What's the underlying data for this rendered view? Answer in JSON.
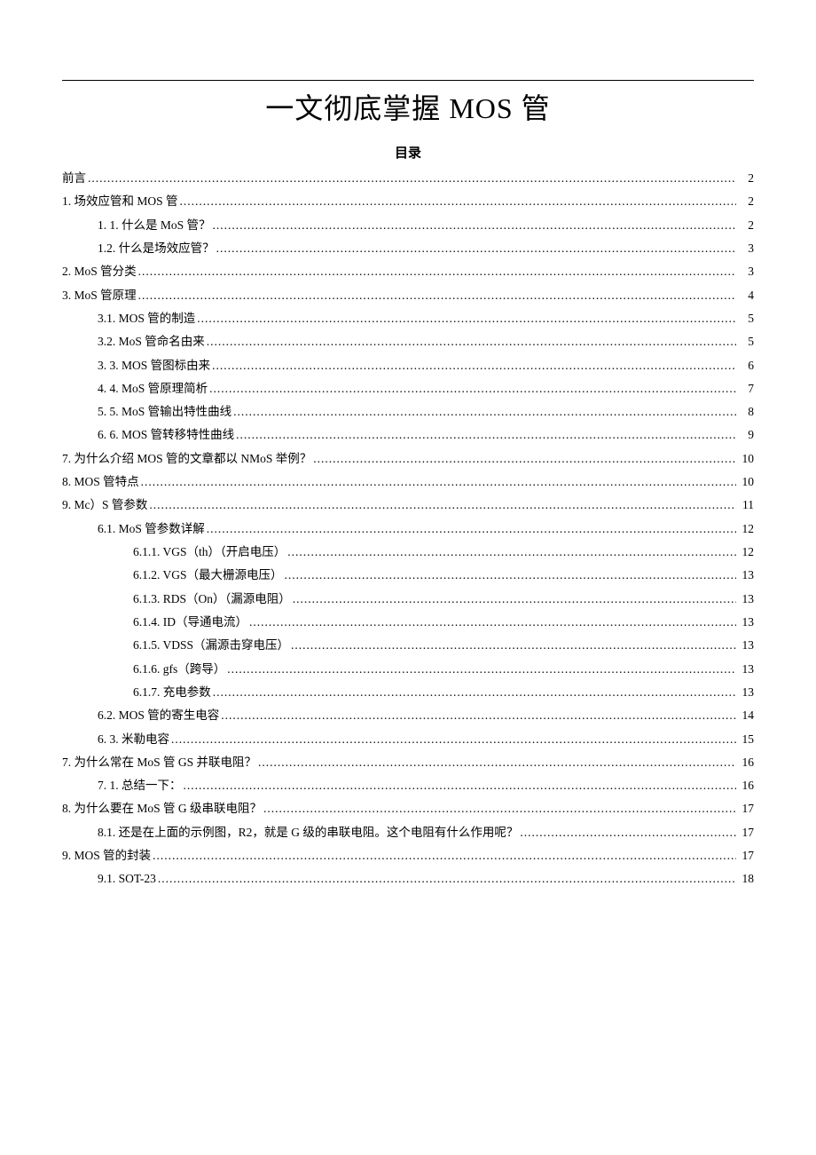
{
  "title_pre": "一文彻底掌握 ",
  "title_latin": "MOS",
  "title_post": " 管",
  "toc_heading": "目录",
  "toc": [
    {
      "level": 0,
      "label": "前言",
      "page": "2"
    },
    {
      "level": 0,
      "label": "1. 场效应管和 MOS 管",
      "page": "2"
    },
    {
      "level": 1,
      "label": "1. 1. 什么是 MoS 管？",
      "page": "2"
    },
    {
      "level": 1,
      "label": "1.2.  什么是场效应管？",
      "page": "3"
    },
    {
      "level": 0,
      "label": "2.  MoS 管分类",
      "page": "3"
    },
    {
      "level": 0,
      "label": "3.  MoS 管原理",
      "page": "4"
    },
    {
      "level": 1,
      "label": "3.1.  MOS 管的制造",
      "page": "5"
    },
    {
      "level": 1,
      "label": "3.2.  MoS 管命名由来",
      "page": "5"
    },
    {
      "level": 1,
      "label": "3. 3. MOS 管图标由来",
      "page": "6"
    },
    {
      "level": 1,
      "label": "4. 4. MoS 管原理简析",
      "page": "7"
    },
    {
      "level": 1,
      "label": "5. 5. MoS 管输出特性曲线",
      "page": "8"
    },
    {
      "level": 1,
      "label": "6. 6. MOS 管转移特性曲线",
      "page": "9"
    },
    {
      "level": 0,
      "label": "7.  为什么介绍 MOS 管的文章都以 NMoS 举例？",
      "page": "10"
    },
    {
      "level": 0,
      "label": "8.  MOS 管特点",
      "page": "10"
    },
    {
      "level": 0,
      "label": "9.  Mc）S 管参数",
      "page": "11"
    },
    {
      "level": 1,
      "label": "6.1. MoS 管参数详解",
      "page": "12"
    },
    {
      "level": 2,
      "label": "6.1.1.  VGS（th）（开启电压）",
      "page": "12"
    },
    {
      "level": 2,
      "label": "6.1.2.  VGS（最大栅源电压）",
      "page": "13"
    },
    {
      "level": 2,
      "label": "6.1.3.  RDS（On）（漏源电阻）",
      "page": "13"
    },
    {
      "level": 2,
      "label": "6.1.4.  ID（导通电流）",
      "page": "13"
    },
    {
      "level": 2,
      "label": "6.1.5.  VDSS（漏源击穿电压）",
      "page": "13"
    },
    {
      "level": 2,
      "label": "6.1.6.  gfs（跨导）",
      "page": "13"
    },
    {
      "level": 2,
      "label": "6.1.7. 充电参数",
      "page": "13"
    },
    {
      "level": 1,
      "label": "6.2. MOS 管的寄生电容",
      "page": "14"
    },
    {
      "level": 1,
      "label": "6. 3. 米勒电容",
      "page": "15"
    },
    {
      "level": 0,
      "label": "7. 为什么常在 MoS 管 GS 并联电阻？",
      "page": "16"
    },
    {
      "level": 1,
      "label": "7. 1. 总结一下：",
      "page": "16"
    },
    {
      "level": 0,
      "label": "8.  为什么要在 MoS 管 G 级串联电阻？",
      "page": "17"
    },
    {
      "level": 1,
      "label": "8.1.  还是在上面的示例图，R2，就是 G 级的串联电阻。这个电阻有什么作用呢？",
      "page": "17"
    },
    {
      "level": 0,
      "label": "9.  MOS 管的封装",
      "page": "17"
    },
    {
      "level": 1,
      "label": "9.1. SOT-23",
      "page": "18"
    }
  ]
}
